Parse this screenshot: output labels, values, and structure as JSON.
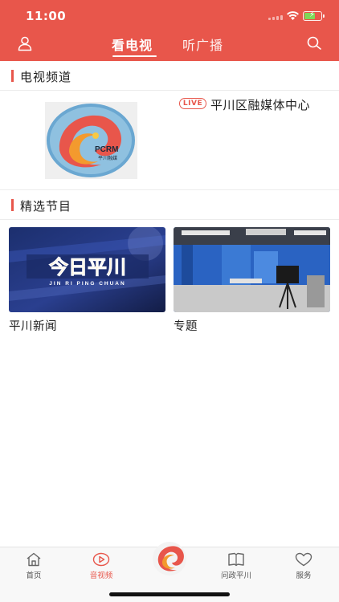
{
  "status_bar": {
    "time": "11:00"
  },
  "header": {
    "tabs": [
      {
        "label": "看电视",
        "active": true
      },
      {
        "label": "听广播",
        "active": false
      }
    ]
  },
  "sections": {
    "tv_channels": {
      "title": "电视频道",
      "channel": {
        "badge": "LIVE",
        "name": "平川区融媒体中心",
        "logo_text": "PCRM",
        "logo_subtext": "平川融媒"
      }
    },
    "featured": {
      "title": "精选节目",
      "items": [
        {
          "title": "平川新闻",
          "banner_text": "今日平川",
          "banner_subtext": "JIN RI PING CHUAN"
        },
        {
          "title": "专题",
          "banner_text": ""
        }
      ]
    }
  },
  "bottom_nav": {
    "items": [
      {
        "label": "首页",
        "icon": "home-icon",
        "active": false
      },
      {
        "label": "音视频",
        "icon": "video-play-icon",
        "active": true
      },
      {
        "label": "",
        "icon": "center-logo-icon",
        "active": false
      },
      {
        "label": "问政平川",
        "icon": "book-icon",
        "active": false
      },
      {
        "label": "服务",
        "icon": "heart-icon",
        "active": false
      }
    ]
  },
  "colors": {
    "brand": "#e8564b",
    "active_tab": "#e8564b",
    "text": "#222222"
  }
}
